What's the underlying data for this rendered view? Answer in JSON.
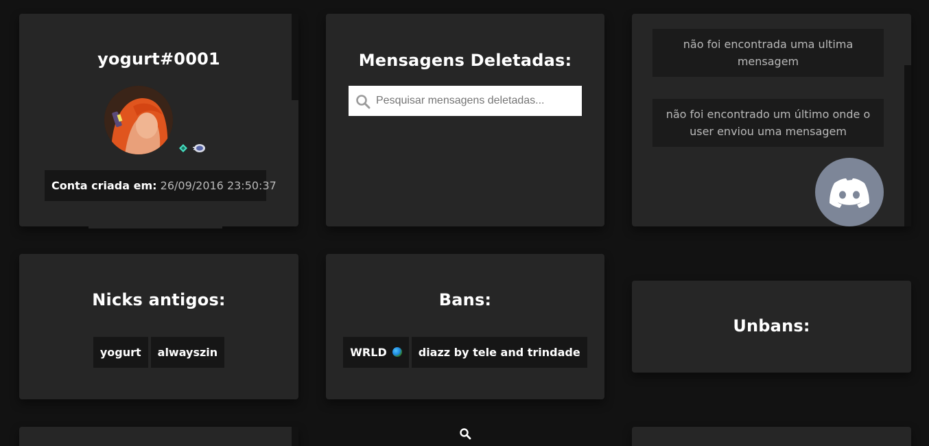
{
  "profile": {
    "username": "yogurt#0001",
    "created_label": "Conta criada em:",
    "created_value": "26/09/2016 23:50:37",
    "badges": [
      "hypesquad-balance-icon",
      "nitro-icon"
    ]
  },
  "deleted_messages": {
    "title": "Mensagens Deletadas:",
    "search_placeholder": "Pesquisar mensagens deletadas..."
  },
  "activity": {
    "last_message": "não foi encontrada uma ultima mensagem",
    "last_location": "não foi encontrado um último onde o user enviou uma mensagem",
    "discord_icon": "discord-icon"
  },
  "old_nicks": {
    "title": "Nicks antigos:",
    "items": [
      "yogurt",
      "alwayszin"
    ]
  },
  "bans": {
    "title": "Bans:",
    "items": [
      "WRLD",
      "diazz by tele and trindade"
    ]
  },
  "unbans": {
    "title": "Unbans:"
  },
  "colors": {
    "background": "#121212",
    "card": "#262626",
    "chip": "#161616",
    "discord": "#7d8698",
    "hypesquad": "#45ddc0"
  }
}
